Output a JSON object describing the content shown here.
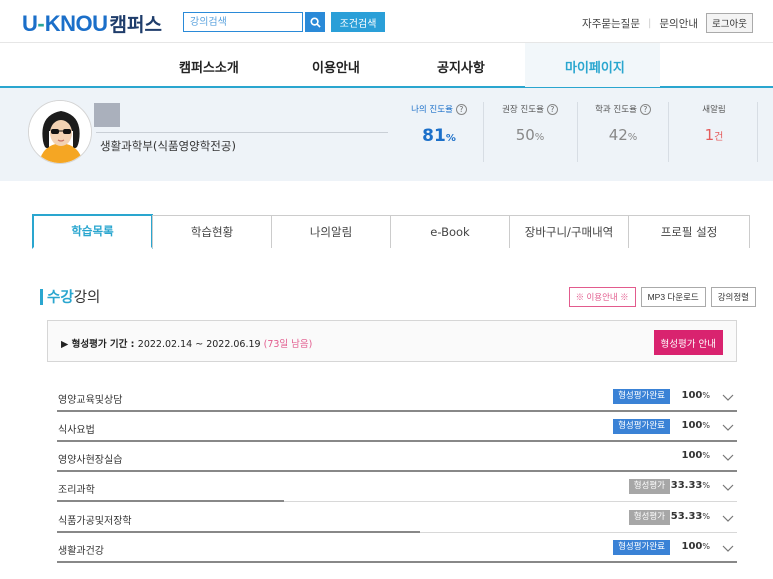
{
  "header": {
    "logo_u": "U",
    "logo_dash": "-",
    "logo_knou": "KNOU",
    "logo_campus": "캠퍼스",
    "search_placeholder": "강의검색",
    "condition_search": "조건검색",
    "faq": "자주묻는질문",
    "inquiry": "문의안내",
    "logout": "로그아웃"
  },
  "nav": {
    "items": [
      "캠퍼스소개",
      "이용안내",
      "공지사항",
      "마이페이지"
    ],
    "active": "마이페이지"
  },
  "profile": {
    "department": "생활과학부(식품영양학전공)",
    "stats": [
      {
        "label": "나의 진도율",
        "value": "81",
        "unit": "%",
        "help": "?"
      },
      {
        "label": "권장 진도율",
        "value": "50",
        "unit": "%",
        "help": "?"
      },
      {
        "label": "학과 진도율",
        "value": "42",
        "unit": "%",
        "help": "?"
      },
      {
        "label": "새알림",
        "value": "1",
        "unit": "건"
      }
    ]
  },
  "tabs": [
    "학습목록",
    "학습현황",
    "나의알림",
    "e-Book",
    "장바구니/구매내역",
    "프로필 설정"
  ],
  "section": {
    "title_highlight": "수강",
    "title_rest": "강의",
    "buttons": [
      "※ 이용안내 ※",
      "MP3 다운로드",
      "강의정렬"
    ]
  },
  "eval": {
    "arrow": "▶",
    "label": "형성평가 기간 : ",
    "period": "2022.02.14 ~ 2022.06.19",
    "remaining": "(73일 남음)",
    "button": "형성평가 안내"
  },
  "courses": [
    {
      "name": "영양교육및상담",
      "badge": "형성평가완료",
      "badge_color": "#3a82d6",
      "pct": "100",
      "unit": "%",
      "progress": 1.0
    },
    {
      "name": "식사요법",
      "badge": "형성평가완료",
      "badge_color": "#3a82d6",
      "pct": "100",
      "unit": "%",
      "progress": 1.0
    },
    {
      "name": "영양사현장실습",
      "badge": "",
      "pct": "100",
      "unit": "%",
      "progress": 1.0
    },
    {
      "name": "조리과학",
      "badge": "형성평가",
      "badge_color": "#a7a7a7",
      "pct": "33.33",
      "unit": "%",
      "progress": 0.3333
    },
    {
      "name": "식품가공및저장학",
      "badge": "형성평가",
      "badge_color": "#a7a7a7",
      "pct": "53.33",
      "unit": "%",
      "progress": 0.5333
    },
    {
      "name": "생활과건강",
      "badge": "형성평가완료",
      "badge_color": "#3a82d6",
      "pct": "100",
      "unit": "%",
      "progress": 1.0
    }
  ]
}
